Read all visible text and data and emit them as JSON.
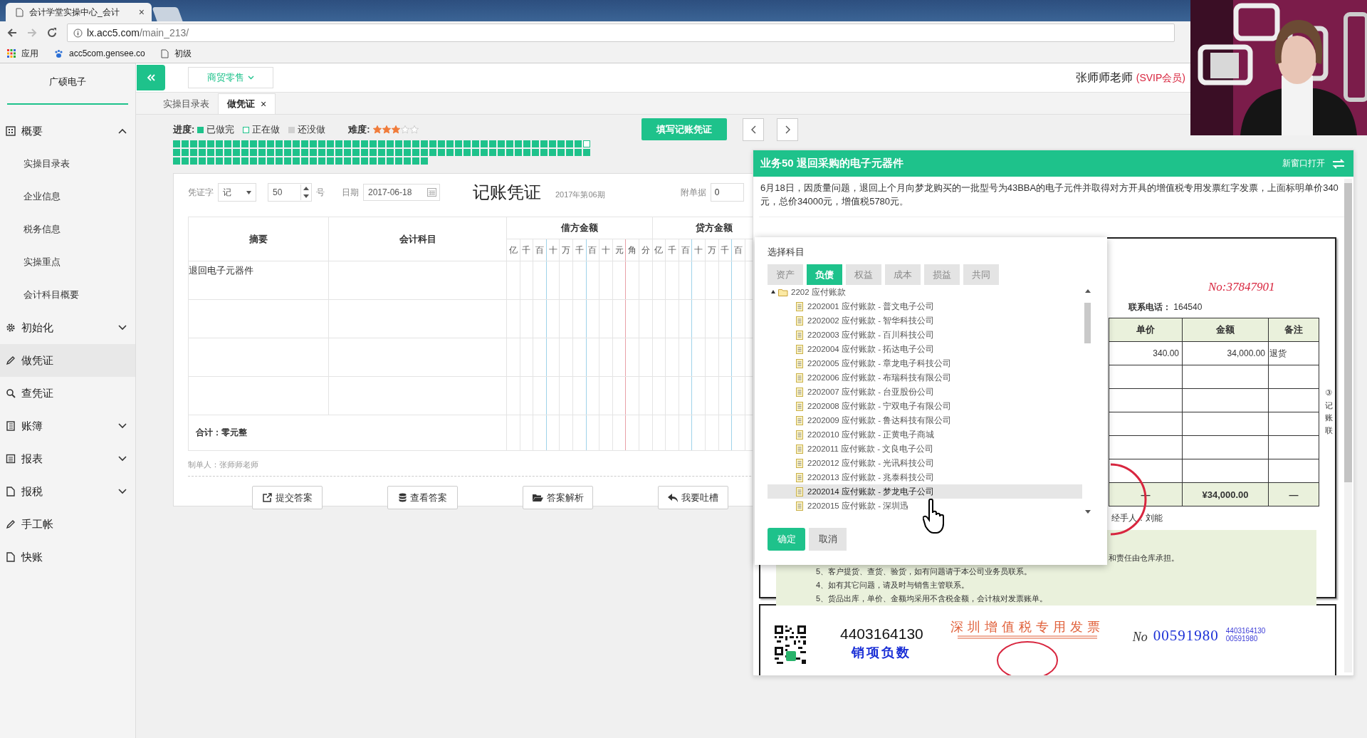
{
  "browser": {
    "tab_title": "会计学堂实操中心_会计",
    "tab_close": "×",
    "address_host": "lx.acc5.com",
    "address_path": "/main_213/",
    "bookmarks": [
      {
        "label": "应用",
        "kind": "apps"
      },
      {
        "label": "acc5com.gensee.co",
        "kind": "paw"
      },
      {
        "label": "初级",
        "kind": "page"
      }
    ]
  },
  "sidebar": {
    "company": "广硕电子",
    "items": [
      {
        "label": "概要",
        "kind": "group",
        "expanded": true,
        "selected": false,
        "children": [
          {
            "label": "实操目录表",
            "selected": false
          },
          {
            "label": "企业信息",
            "selected": false
          },
          {
            "label": "税务信息",
            "selected": false
          },
          {
            "label": "实操重点",
            "selected": false
          },
          {
            "label": "会计科目概要",
            "selected": false
          }
        ]
      },
      {
        "label": "初始化",
        "kind": "group",
        "expanded": false,
        "selected": false
      },
      {
        "label": "做凭证",
        "kind": "link",
        "selected": true
      },
      {
        "label": "查凭证",
        "kind": "link",
        "selected": false
      },
      {
        "label": "账簿",
        "kind": "group",
        "expanded": false,
        "selected": false
      },
      {
        "label": "报表",
        "kind": "group",
        "expanded": false,
        "selected": false
      },
      {
        "label": "报税",
        "kind": "group",
        "expanded": false,
        "selected": false
      },
      {
        "label": "手工帐",
        "kind": "link",
        "selected": false
      },
      {
        "label": "快账",
        "kind": "link",
        "selected": false
      }
    ]
  },
  "header": {
    "industry": "商贸零售",
    "user": "张师师老师",
    "badge": "(SVIP会员)"
  },
  "tabs": [
    {
      "label": "实操目录表",
      "selected": false
    },
    {
      "label": "做凭证",
      "selected": true,
      "close": "×"
    }
  ],
  "progress": {
    "label": "进度:",
    "legend": [
      {
        "label": "已做完",
        "kind": "done"
      },
      {
        "label": "正在做",
        "kind": "doing"
      },
      {
        "label": "还没做",
        "kind": "todo"
      }
    ],
    "difficulty_label": "难度:",
    "stars": 3,
    "cells": [
      {
        "kind": "done"
      },
      {
        "kind": "done"
      },
      {
        "kind": "done"
      },
      {
        "kind": "done"
      },
      {
        "kind": "done"
      },
      {
        "kind": "done"
      },
      {
        "kind": "done"
      },
      {
        "kind": "done"
      },
      {
        "kind": "done"
      },
      {
        "kind": "done"
      },
      {
        "kind": "done"
      },
      {
        "kind": "done"
      },
      {
        "kind": "done"
      },
      {
        "kind": "done"
      },
      {
        "kind": "done"
      },
      {
        "kind": "done"
      },
      {
        "kind": "done"
      },
      {
        "kind": "done"
      },
      {
        "kind": "done"
      },
      {
        "kind": "done"
      },
      {
        "kind": "done"
      },
      {
        "kind": "done"
      },
      {
        "kind": "done"
      },
      {
        "kind": "done"
      },
      {
        "kind": "done"
      },
      {
        "kind": "done"
      },
      {
        "kind": "done"
      },
      {
        "kind": "done"
      },
      {
        "kind": "done"
      },
      {
        "kind": "done"
      },
      {
        "kind": "done"
      },
      {
        "kind": "done"
      },
      {
        "kind": "done"
      },
      {
        "kind": "done"
      },
      {
        "kind": "done"
      },
      {
        "kind": "done"
      },
      {
        "kind": "done"
      },
      {
        "kind": "done"
      },
      {
        "kind": "done"
      },
      {
        "kind": "done"
      },
      {
        "kind": "done"
      },
      {
        "kind": "done"
      },
      {
        "kind": "done"
      },
      {
        "kind": "done"
      },
      {
        "kind": "done"
      },
      {
        "kind": "done"
      },
      {
        "kind": "done"
      },
      {
        "kind": "done"
      },
      {
        "kind": "doing"
      },
      {
        "kind": "done"
      },
      {
        "kind": "done"
      },
      {
        "kind": "done"
      },
      {
        "kind": "done"
      },
      {
        "kind": "done"
      },
      {
        "kind": "done"
      },
      {
        "kind": "done"
      },
      {
        "kind": "done"
      },
      {
        "kind": "done"
      },
      {
        "kind": "done"
      },
      {
        "kind": "done"
      },
      {
        "kind": "done"
      },
      {
        "kind": "done"
      },
      {
        "kind": "done"
      },
      {
        "kind": "done"
      },
      {
        "kind": "done"
      },
      {
        "kind": "done"
      },
      {
        "kind": "done"
      },
      {
        "kind": "done"
      },
      {
        "kind": "done"
      },
      {
        "kind": "done"
      },
      {
        "kind": "done"
      },
      {
        "kind": "done"
      },
      {
        "kind": "done"
      },
      {
        "kind": "done"
      },
      {
        "kind": "done"
      },
      {
        "kind": "done"
      },
      {
        "kind": "done"
      },
      {
        "kind": "done"
      },
      {
        "kind": "done"
      },
      {
        "kind": "done"
      },
      {
        "kind": "done"
      },
      {
        "kind": "done"
      },
      {
        "kind": "done"
      },
      {
        "kind": "done"
      },
      {
        "kind": "done"
      },
      {
        "kind": "done"
      },
      {
        "kind": "done"
      },
      {
        "kind": "done"
      },
      {
        "kind": "done"
      },
      {
        "kind": "done"
      },
      {
        "kind": "done"
      },
      {
        "kind": "done"
      },
      {
        "kind": "done"
      },
      {
        "kind": "done"
      },
      {
        "kind": "done"
      },
      {
        "kind": "done"
      },
      {
        "kind": "done"
      },
      {
        "kind": "done"
      },
      {
        "kind": "done"
      },
      {
        "kind": "done"
      },
      {
        "kind": "done"
      },
      {
        "kind": "done"
      },
      {
        "kind": "done"
      },
      {
        "kind": "done"
      },
      {
        "kind": "done"
      },
      {
        "kind": "done"
      },
      {
        "kind": "done"
      },
      {
        "kind": "done"
      },
      {
        "kind": "done"
      },
      {
        "kind": "done"
      },
      {
        "kind": "done"
      },
      {
        "kind": "done"
      },
      {
        "kind": "done"
      },
      {
        "kind": "done"
      },
      {
        "kind": "done"
      },
      {
        "kind": "done"
      },
      {
        "kind": "done"
      },
      {
        "kind": "done"
      },
      {
        "kind": "done"
      },
      {
        "kind": "done"
      },
      {
        "kind": "done"
      },
      {
        "kind": "done"
      },
      {
        "kind": "done"
      },
      {
        "kind": "done"
      },
      {
        "kind": "done"
      },
      {
        "kind": "done"
      },
      {
        "kind": "done"
      },
      {
        "kind": "done"
      }
    ]
  },
  "fill_button": "填写记账凭证",
  "voucher": {
    "word_label": "凭证字",
    "word": "记",
    "number": "50",
    "number_suffix": "号",
    "date_label": "日期",
    "date": "2017-06-18",
    "title": "记账凭证",
    "period": "2017年第06期",
    "attachments_label": "附单据",
    "attachments": "0",
    "columns": {
      "summary": "摘要",
      "account": "会计科目",
      "debit": "借方金额",
      "credit": "贷方金额"
    },
    "debit_digits": [
      "亿",
      "千",
      "百",
      "十",
      "万",
      "千",
      "百",
      "十",
      "元",
      "角",
      "分"
    ],
    "credit_digits": [
      "亿",
      "千",
      "百",
      "十",
      "万",
      "千",
      "百"
    ],
    "rows": [
      {
        "summary": "退回电子元器件"
      }
    ],
    "total": "合计：零元整",
    "maker": "制单人：张师师老师",
    "buttons": [
      {
        "label": "提交答案",
        "kind": "submit"
      },
      {
        "label": "查看答案",
        "kind": "view"
      },
      {
        "label": "答案解析",
        "kind": "explain"
      },
      {
        "label": "我要吐槽",
        "kind": "feedback"
      }
    ]
  },
  "task_panel": {
    "title": "业务50 退回采购的电子元器件",
    "open_new": "新窗口打开",
    "description": "6月18日，因质量问题，退回上个月向梦龙购买的一批型号为43BBA的电子元件并取得对方开具的增值税专用发票红字发票，上面标明单价340元，总价34000元，增值税5780元。"
  },
  "invoice": {
    "number": "No:37847901",
    "phone_label": "联系电话：",
    "phone": "164540",
    "columns": [
      "单价",
      "金额",
      "备注"
    ],
    "rows": [
      [
        "340.00",
        "34,000.00",
        "退货"
      ],
      [
        "",
        "",
        ""
      ],
      [
        "",
        "",
        ""
      ],
      [
        "",
        "",
        ""
      ],
      [
        "",
        "",
        ""
      ],
      [
        "",
        "",
        ""
      ]
    ],
    "totals": [
      "—",
      "¥34,000.00",
      "—"
    ],
    "handler": "经手人：刘能",
    "copy_label": "③记账联",
    "note_tail": "和责任由仓库承担。",
    "notes": [
      "5、客户提货、查货、验货，如有问题请于本公司业务员联系。",
      "4、如有其它问题，请及时与销售主管联系。",
      "5、货品出库，单价、金额均采用不含税金额，会计核对发票账单。"
    ]
  },
  "vat_invoice": {
    "code": "4403164130",
    "red_label": "销项负数",
    "title": "深圳增值税专用发票",
    "no_label": "No",
    "number": "00591980",
    "small_code": "4403164130",
    "small_number": "00591980"
  },
  "account_dialog": {
    "title": "选择科目",
    "tabs": [
      {
        "label": "资产",
        "selected": false
      },
      {
        "label": "负债",
        "selected": true
      },
      {
        "label": "权益",
        "selected": false
      },
      {
        "label": "成本",
        "selected": false
      },
      {
        "label": "损益",
        "selected": false
      },
      {
        "label": "共同",
        "selected": false
      }
    ],
    "tree": [
      {
        "label": "2202 应付账款",
        "expanded": true,
        "selected": false,
        "children": [
          {
            "label": "2202001 应付账款 - 普文电子公司",
            "selected": false
          },
          {
            "label": "2202002 应付账款 - 智华科技公司",
            "selected": false
          },
          {
            "label": "2202003 应付账款 - 百川科技公司",
            "selected": false
          },
          {
            "label": "2202004 应付账款 - 拓达电子公司",
            "selected": false
          },
          {
            "label": "2202005 应付账款 - 章龙电子科技公司",
            "selected": false
          },
          {
            "label": "2202006 应付账款 - 布瑞科技有限公司",
            "selected": false
          },
          {
            "label": "2202007 应付账款 - 台亚股份公司",
            "selected": false
          },
          {
            "label": "2202008 应付账款 - 宁双电子有限公司",
            "selected": false
          },
          {
            "label": "2202009 应付账款 - 鲁达科技有限公司",
            "selected": false
          },
          {
            "label": "2202010 应付账款 - 正黄电子商城",
            "selected": false
          },
          {
            "label": "2202011 应付账款 - 文良电子公司",
            "selected": false
          },
          {
            "label": "2202012 应付账款 - 光讯科技公司",
            "selected": false
          },
          {
            "label": "2202013 应付账款 - 兆泰科技公司",
            "selected": false
          },
          {
            "label": "2202014 应付账款 - 梦龙电子公司",
            "selected": true
          },
          {
            "label": "2202015 应付账款 - 深圳迅",
            "selected": false
          }
        ]
      }
    ],
    "ok": "确定",
    "cancel": "取消"
  }
}
